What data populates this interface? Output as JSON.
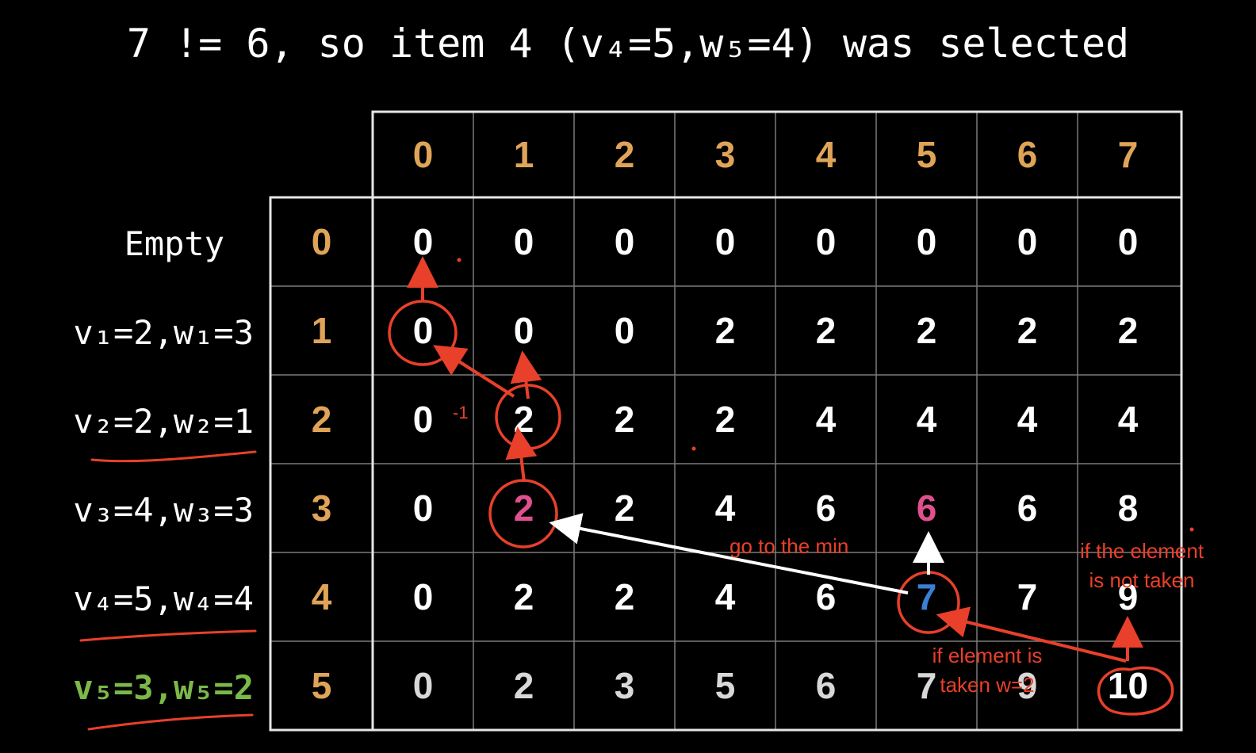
{
  "title": "7 != 6, so item 4 (v₄=5,w₅=4) was selected",
  "column_headers": [
    "0",
    "1",
    "2",
    "3",
    "4",
    "5",
    "6",
    "7"
  ],
  "row_headers": [
    "0",
    "1",
    "2",
    "3",
    "4",
    "5"
  ],
  "row_labels": [
    "Empty",
    "v₁=2,w₁=3",
    "v₂=2,w₂=1",
    "v₃=4,w₃=3",
    "v₄=5,w₄=4",
    "v₅=3,w₅=2"
  ],
  "table": [
    [
      "0",
      "0",
      "0",
      "0",
      "0",
      "0",
      "0",
      "0"
    ],
    [
      "0",
      "0",
      "0",
      "2",
      "2",
      "2",
      "2",
      "2"
    ],
    [
      "0",
      "2",
      "2",
      "2",
      "4",
      "4",
      "4",
      "4"
    ],
    [
      "0",
      "2",
      "2",
      "4",
      "6",
      "6",
      "6",
      "8"
    ],
    [
      "0",
      "2",
      "2",
      "4",
      "6",
      "7",
      "7",
      "9"
    ],
    [
      "0",
      "2",
      "3",
      "5",
      "6",
      "7",
      "9",
      "10"
    ]
  ],
  "annotations": {
    "minus_one": "-1",
    "go_to_min": "go to the min",
    "not_taken_line1": "if the element",
    "not_taken_line2": "is not taken",
    "taken_line1": "if element is",
    "taken_line2": "taken w=2"
  },
  "colors": {
    "background": "#000000",
    "header": "#e0a458",
    "annotation_red": "#e8402a",
    "highlight_pink": "#e0508f",
    "highlight_blue": "#3a7fd4",
    "selected_green": "#7bb84a",
    "grid_white": "#ffffff",
    "grid_inner": "#7a7a7a"
  }
}
